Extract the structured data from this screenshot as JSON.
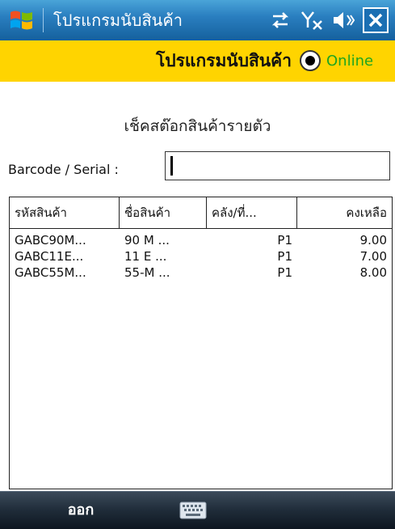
{
  "window": {
    "title": "โปรแกรมนับสินค้า",
    "status_icons": [
      "sync-icon",
      "no-signal-icon",
      "volume-icon"
    ],
    "close_label": "✕"
  },
  "header": {
    "app_title": "โปรแกรมนับสินค้า",
    "mode_label": "Online",
    "mode_selected": true
  },
  "form": {
    "subtitle": "เช็คสต๊อกสินค้ารายตัว",
    "barcode_label": "Barcode / Serial :",
    "barcode_value": ""
  },
  "table": {
    "columns": [
      "รหัสสินค้า",
      "ชื่อสินค้า",
      "คลัง/ที่...",
      "คงเหลือ"
    ],
    "rows": [
      [
        "GABC90M...",
        "90 M ...",
        "P1",
        "9.00"
      ],
      [
        "GABC11E...",
        "11 E ...",
        "P1",
        "7.00"
      ],
      [
        "GABC55M...",
        "55-M ...",
        "P1",
        "8.00"
      ]
    ]
  },
  "bottom": {
    "left_softkey": "ออก",
    "keyboard_icon": "keyboard-icon"
  }
}
